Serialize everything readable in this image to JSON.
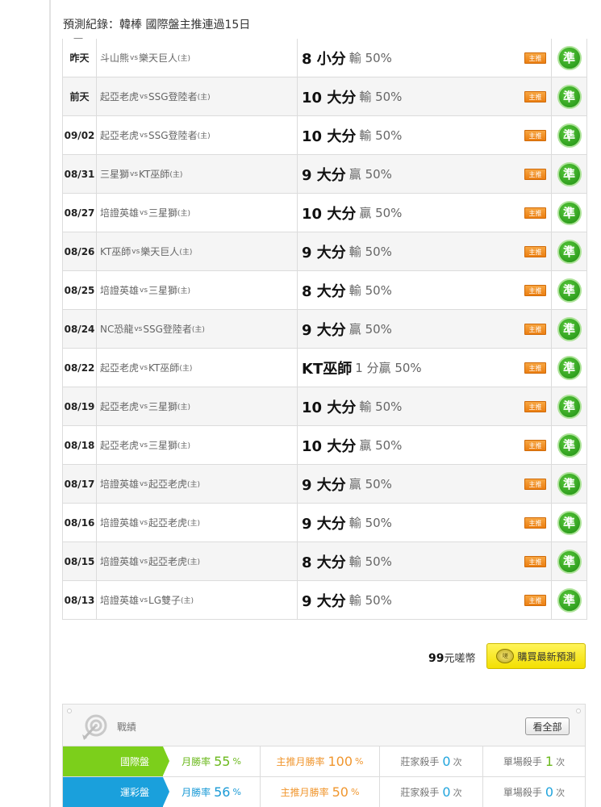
{
  "header": {
    "title": "預測紀錄：韓棒 國際盤主推連過15日"
  },
  "badge_label": "主推",
  "stamp_label": "準",
  "records": [
    {
      "date": "昨天",
      "away": "斗山熊",
      "vs": "vs",
      "home": "樂天巨人",
      "home_tag": "(主)",
      "pick": "8 小分",
      "result": "輸 50%"
    },
    {
      "date": "前天",
      "away": "起亞老虎",
      "vs": "vs",
      "home": "SSG登陸者",
      "home_tag": "(主)",
      "pick": "10 大分",
      "result": "輸 50%"
    },
    {
      "date": "09/02",
      "away": "起亞老虎",
      "vs": "vs",
      "home": "SSG登陸者",
      "home_tag": "(主)",
      "pick": "10 大分",
      "result": "輸 50%"
    },
    {
      "date": "08/31",
      "away": "三星獅",
      "vs": "vs",
      "home": "KT巫師",
      "home_tag": "(主)",
      "pick": "9 大分",
      "result": "贏 50%"
    },
    {
      "date": "08/27",
      "away": "培證英雄",
      "vs": "vs",
      "home": "三星獅",
      "home_tag": "(主)",
      "pick": "10 大分",
      "result": "贏 50%"
    },
    {
      "date": "08/26",
      "away": "KT巫師",
      "vs": "vs",
      "home": "樂天巨人",
      "home_tag": "(主)",
      "pick": "9 大分",
      "result": "輸 50%"
    },
    {
      "date": "08/25",
      "away": "培證英雄",
      "vs": "vs",
      "home": "三星獅",
      "home_tag": "(主)",
      "pick": "8 大分",
      "result": "輸 50%"
    },
    {
      "date": "08/24",
      "away": "NC恐龍",
      "vs": "vs",
      "home": "SSG登陸者",
      "home_tag": "(主)",
      "pick": "9 大分",
      "result": "贏 50%"
    },
    {
      "date": "08/22",
      "away": "起亞老虎",
      "vs": "vs",
      "home": "KT巫師",
      "home_tag": "(主)",
      "pick": "KT巫師",
      "result": "1 分贏 50%"
    },
    {
      "date": "08/19",
      "away": "起亞老虎",
      "vs": "vs",
      "home": "三星獅",
      "home_tag": "(主)",
      "pick": "10 大分",
      "result": "輸 50%"
    },
    {
      "date": "08/18",
      "away": "起亞老虎",
      "vs": "vs",
      "home": "三星獅",
      "home_tag": "(主)",
      "pick": "10 大分",
      "result": "贏 50%"
    },
    {
      "date": "08/17",
      "away": "培證英雄",
      "vs": "vs",
      "home": "起亞老虎",
      "home_tag": "(主)",
      "pick": "9 大分",
      "result": "贏 50%"
    },
    {
      "date": "08/16",
      "away": "培證英雄",
      "vs": "vs",
      "home": "起亞老虎",
      "home_tag": "(主)",
      "pick": "9 大分",
      "result": "輸 50%"
    },
    {
      "date": "08/15",
      "away": "培證英雄",
      "vs": "vs",
      "home": "起亞老虎",
      "home_tag": "(主)",
      "pick": "8 大分",
      "result": "輸 50%"
    },
    {
      "date": "08/13",
      "away": "培證英雄",
      "vs": "vs",
      "home": "LG雙子",
      "home_tag": "(主)",
      "pick": "9 大分",
      "result": "輸 50%"
    }
  ],
  "purchase": {
    "price": "99",
    "currency": "元嗟幣",
    "button_label": "購買最新預測",
    "icon_label": "嗟"
  },
  "stats": {
    "title": "戰績",
    "view_all": "看全部",
    "rows": [
      {
        "name": "國際盤",
        "color": "#7ccf1b",
        "win_label": "月勝率",
        "win": "55",
        "win_unit": "%",
        "win_color": "#6cb91e",
        "main_label": "主推月勝率",
        "main": "100",
        "main_unit": "%",
        "main_color": "#f0962e",
        "banker_label": "莊家殺手",
        "banker": "0",
        "banker_unit": "次",
        "banker_color": "#21a5dd",
        "single_label": "單場殺手",
        "single": "1",
        "single_unit": "次",
        "single_color": "#6cb91e"
      },
      {
        "name": "運彩盤",
        "color": "#1aa0dc",
        "win_label": "月勝率",
        "win": "56",
        "win_unit": "%",
        "win_color": "#1a9ad6",
        "main_label": "主推月勝率",
        "main": "50",
        "main_unit": "%",
        "main_color": "#f0962e",
        "banker_label": "莊家殺手",
        "banker": "0",
        "banker_unit": "次",
        "banker_color": "#21a5dd",
        "single_label": "單場殺手",
        "single": "0",
        "single_unit": "次",
        "single_color": "#21a5dd"
      }
    ]
  }
}
